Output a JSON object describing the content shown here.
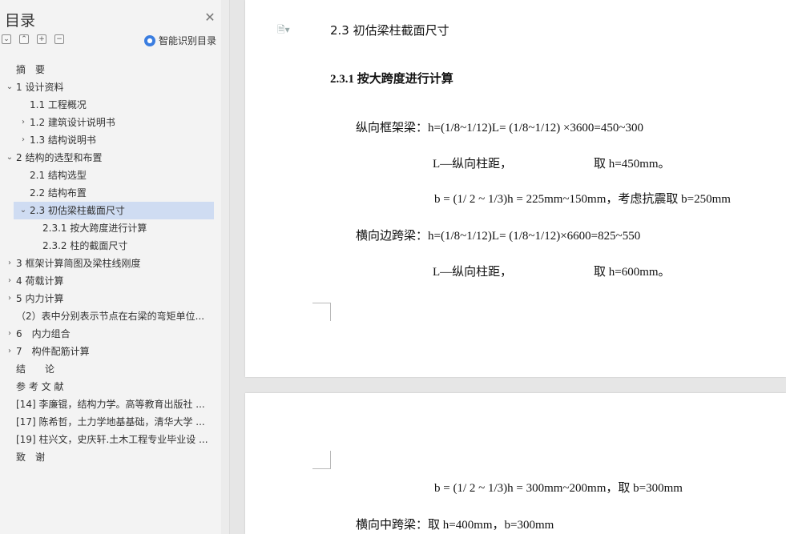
{
  "sidebar": {
    "title": "目录",
    "close_label": "✕",
    "tools": [
      "⌄",
      "⌃",
      "+",
      "−"
    ],
    "smart_toc_label": "智能识别目录",
    "items": [
      {
        "label": "摘　要",
        "level": 0,
        "caret": ""
      },
      {
        "label": "1 设计资料",
        "level": 0,
        "caret": "down"
      },
      {
        "label": "1.1 工程概况",
        "level": 1,
        "caret": ""
      },
      {
        "label": "1.2 建筑设计说明书",
        "level": 1,
        "caret": "right"
      },
      {
        "label": "1.3 结构说明书",
        "level": 1,
        "caret": "right"
      },
      {
        "label": "2 结构的选型和布置",
        "level": 0,
        "caret": "down"
      },
      {
        "label": "2.1 结构选型",
        "level": 1,
        "caret": ""
      },
      {
        "label": "2.2 结构布置",
        "level": 1,
        "caret": ""
      },
      {
        "label": "2.3 初估梁柱截面尺寸",
        "level": 1,
        "caret": "down",
        "active": true
      },
      {
        "label": "2.3.1 按大跨度进行计算",
        "level": 2,
        "caret": ""
      },
      {
        "label": "2.3.2 柱的截面尺寸",
        "level": 2,
        "caret": ""
      },
      {
        "label": "3 框架计算简图及梁柱线刚度",
        "level": 0,
        "caret": "right"
      },
      {
        "label": "4 荷载计算",
        "level": 0,
        "caret": "right"
      },
      {
        "label": "5 内力计算",
        "level": 0,
        "caret": "right"
      },
      {
        "label": "（2）表中分别表示节点在右梁的弯矩单位...",
        "level": 0,
        "caret": ""
      },
      {
        "label": "6　内力组合",
        "level": 0,
        "caret": "right"
      },
      {
        "label": "7　构件配筋计算",
        "level": 0,
        "caret": "right"
      },
      {
        "label": "结　　论",
        "level": 0,
        "caret": ""
      },
      {
        "label": "参 考 文 献",
        "level": 0,
        "caret": ""
      },
      {
        "label": "[14] 李廉锟，结构力学。高等教育出版社 ...",
        "level": 0,
        "caret": ""
      },
      {
        "label": "[17] 陈希哲，土力学地基基础，清华大学 ...",
        "level": 0,
        "caret": ""
      },
      {
        "label": "[19] 柱兴文，史庆轩.土木工程专业毕业设 ...",
        "level": 0,
        "caret": ""
      },
      {
        "label": "致　谢",
        "level": 0,
        "caret": ""
      }
    ]
  },
  "document": {
    "doc_icon": "🗎▾",
    "heading_23": "2.3  初估梁柱截面尺寸",
    "heading_231": "2.3.1  按大跨度进行计算",
    "line1": "纵向框架梁：h=(1/8~1/12)L= (1/8~1/12) ×3600=450~300",
    "line2": "L—纵向柱距，",
    "line2b": "取 h=450mm。",
    "line3": "b = (1/ 2 ~ 1/3)h = 225mm~150mm，考虑抗震取 b=250mm",
    "line4": "横向边跨梁：h=(1/8~1/12)L= (1/8~1/12)×6600=825~550",
    "line5": "L—纵向柱距，",
    "line5b": "取 h=600mm。",
    "line6": "b = (1/ 2 ~ 1/3)h = 300mm~200mm，取 b=300mm",
    "line7": "横向中跨梁：取 h=400mm，b=300mm"
  }
}
